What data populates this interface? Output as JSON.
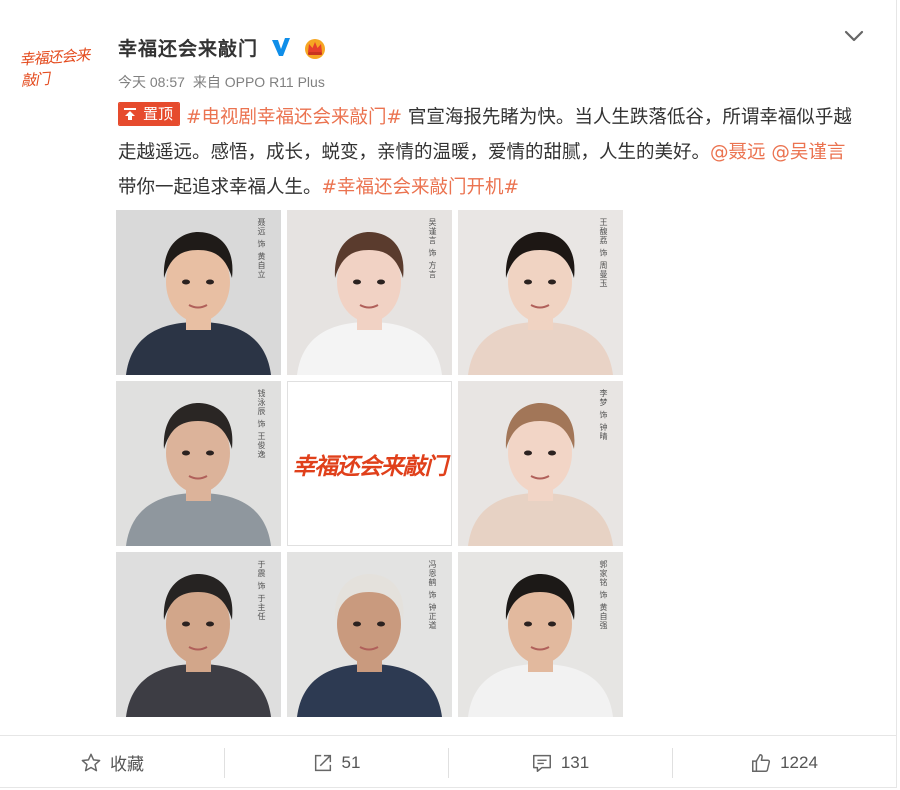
{
  "post": {
    "username": "幸福还会来敲门",
    "timestamp": "今天 08:57",
    "source_prefix": "来自",
    "source_device": "OPPO R11 Plus",
    "avatar_text": "幸福还会来敲门",
    "pinned_label": "置顶",
    "text": {
      "topic1": "#电视剧幸福还会来敲门#",
      "body1": " 官宣海报先睹为快。当人生跌落低谷，所谓幸福似乎越走越遥远。感悟，成长，蜕变，亲情的温暖，爱情的甜腻，人生的美好。",
      "mention1": "@聂远",
      "space1": " ",
      "mention2": "@吴谨言",
      "body2": " 带你一起追求幸福人生。",
      "topic2": "#幸福还会来敲门开机#"
    }
  },
  "images": [
    {
      "name": "poster-nie-yuan",
      "caption": "聂远 饰 黄自立",
      "bg": "#d9d9d9",
      "skin": "#e8bfa3",
      "hair": "#1f1b18",
      "cloth": "#2b3445"
    },
    {
      "name": "poster-wu-jinyan",
      "caption": "吴谨言 饰 方言",
      "bg": "#e6e3e1",
      "skin": "#f1d2c4",
      "hair": "#5a3b2d",
      "cloth": "#f4f4f4"
    },
    {
      "name": "poster-actress-3",
      "caption": "王馥荔 饰 周曼玉",
      "bg": "#e9e6e4",
      "skin": "#f0d3c2",
      "hair": "#1d1714",
      "cloth": "#e9d3c6"
    },
    {
      "name": "poster-actor-4",
      "caption": "钱泳辰 饰 王俊逸",
      "bg": "#e0e0df",
      "skin": "#dcb39a",
      "hair": "#2a2624",
      "cloth": "#8f979e"
    },
    {
      "name": "poster-logo",
      "caption": "幸福还会来敲门",
      "logo": true
    },
    {
      "name": "poster-actress-6",
      "caption": "李梦 饰 钟晴",
      "bg": "#e8e5e3",
      "skin": "#f2d5c6",
      "hair": "#a27658",
      "cloth": "#e7d2c4"
    },
    {
      "name": "poster-actor-7",
      "caption": "于震 饰 于主任",
      "bg": "#dedede",
      "skin": "#d2a68a",
      "hair": "#262322",
      "cloth": "#3d3d44"
    },
    {
      "name": "poster-actor-8",
      "caption": "冯恩鹤 饰 钟正道",
      "bg": "#e3e3e2",
      "skin": "#c99a7e",
      "hair": "#e4e1dc",
      "cloth": "#2d3a52"
    },
    {
      "name": "poster-actor-9",
      "caption": "郭家铭 饰 黄自强",
      "bg": "#e6e5e3",
      "skin": "#e2b99e",
      "hair": "#1c1917",
      "cloth": "#f2f2f2"
    }
  ],
  "actions": {
    "favorite_label": "收藏",
    "repost_count": "51",
    "comment_count": "131",
    "like_count": "1224"
  },
  "colors": {
    "accent": "#eb7350",
    "pin": "#e64b2d",
    "verified": "#0f8ee9",
    "crown": "#f6a623"
  }
}
